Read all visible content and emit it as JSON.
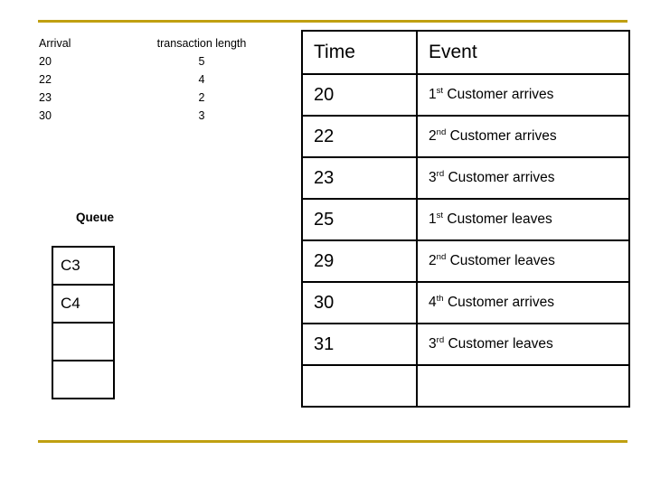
{
  "slide": {
    "accent_color": "#c0a011",
    "arrival_list": {
      "header_left": "Arrival",
      "header_right": "transaction length",
      "rows": [
        {
          "arrival": "20",
          "length": "5"
        },
        {
          "arrival": "22",
          "length": "4"
        },
        {
          "arrival": "23",
          "length": "2"
        },
        {
          "arrival": "30",
          "length": "3"
        }
      ]
    },
    "queue": {
      "label": "Queue",
      "cells": [
        "C3",
        "C4",
        "",
        ""
      ]
    },
    "event_table": {
      "headers": [
        "Time",
        "Event"
      ],
      "rows": [
        {
          "time": "20",
          "event_num": "1",
          "event_sup": "st",
          "event_rest": " Customer arrives"
        },
        {
          "time": "22",
          "event_num": "2",
          "event_sup": "nd",
          "event_rest": " Customer arrives"
        },
        {
          "time": "23",
          "event_num": "3",
          "event_sup": "rd",
          "event_rest": " Customer arrives"
        },
        {
          "time": "25",
          "event_num": "1",
          "event_sup": "st",
          "event_rest": " Customer leaves"
        },
        {
          "time": "29",
          "event_num": "2",
          "event_sup": "nd",
          "event_rest": " Customer leaves"
        },
        {
          "time": "30",
          "event_num": "4",
          "event_sup": "th",
          "event_rest": " Customer arrives"
        },
        {
          "time": "31",
          "event_num": "3",
          "event_sup": "rd",
          "event_rest": " Customer leaves"
        },
        {
          "time": "",
          "event_num": "",
          "event_sup": "",
          "event_rest": ""
        }
      ]
    }
  }
}
